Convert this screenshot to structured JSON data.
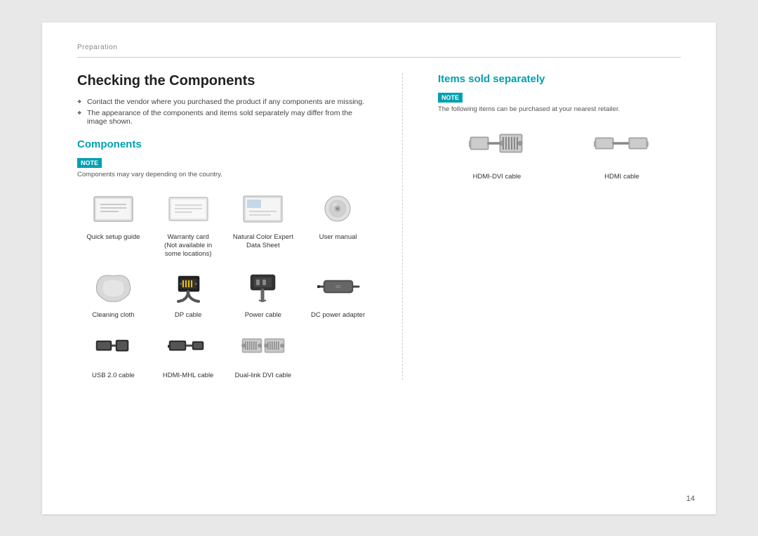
{
  "breadcrumb": "Preparation",
  "page_number": "14",
  "left": {
    "title": "Checking the Components",
    "bullets": [
      "Contact the vendor where you purchased the product if any components are missing.",
      "The appearance of the components and items sold separately may differ from the image shown."
    ],
    "subtitle": "Components",
    "note_label": "NOTE",
    "note_text": "Components may vary depending on the country.",
    "items": [
      {
        "label": "Quick setup guide"
      },
      {
        "label": "Warranty card\n(Not available in\nsome locations)"
      },
      {
        "label": "Natural Color Expert\nData Sheet"
      },
      {
        "label": "User manual"
      },
      {
        "label": "Cleaning cloth"
      },
      {
        "label": "DP cable"
      },
      {
        "label": "Power cable"
      },
      {
        "label": "DC power adapter"
      },
      {
        "label": "USB 2.0 cable"
      },
      {
        "label": "HDMI-MHL cable"
      },
      {
        "label": "Dual-link DVI cable"
      }
    ]
  },
  "right": {
    "title": "Items sold separately",
    "note_label": "NOTE",
    "note_text": "The following items can be purchased at your nearest retailer.",
    "items": [
      {
        "label": "HDMI-DVI cable"
      },
      {
        "label": "HDMI cable"
      }
    ]
  }
}
